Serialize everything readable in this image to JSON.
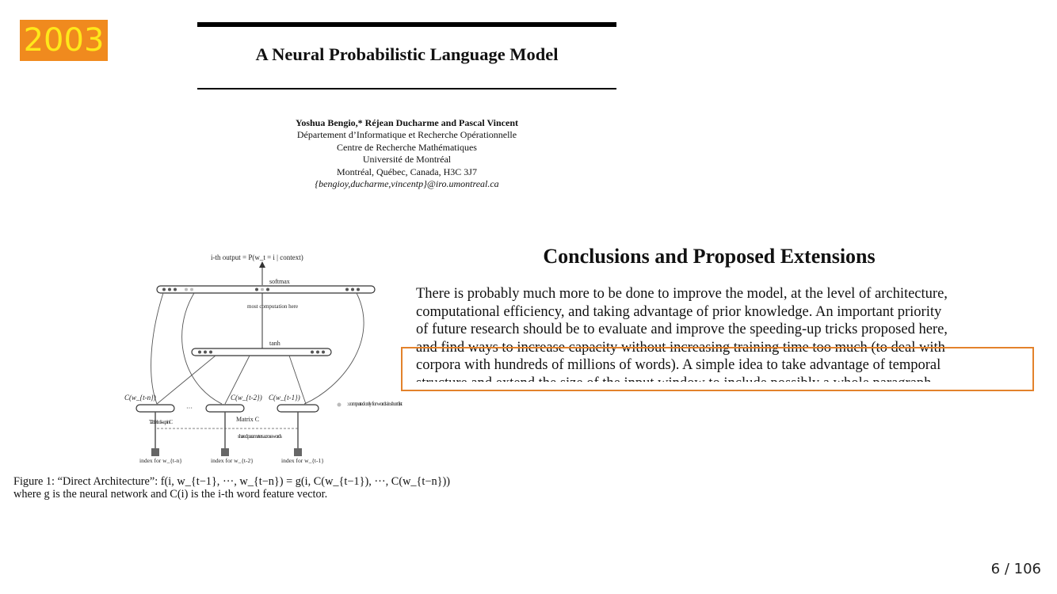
{
  "badge": {
    "year": "2003",
    "bg": "#f08a1e",
    "fg": "#ffe81a"
  },
  "paper": {
    "title": "A Neural Probabilistic Language Model",
    "authors": "Yoshua Bengio,* Réjean Ducharme and Pascal Vincent",
    "affiliation_lines": [
      "Département d’Informatique et Recherche Opérationnelle",
      "Centre de Recherche Mathématiques",
      "Université de Montréal",
      "Montréal, Québec, Canada, H3C 3J7"
    ],
    "email": "{bengioy,ducharme,vincentp}@iro.umontreal.ca"
  },
  "figure": {
    "output_label": "i-th output = P(w_t = i | context)",
    "softmax_label": "softmax",
    "most_computation_label": "most  computation here",
    "tanh_label": "tanh",
    "c_labels": [
      "C(w_{t-n})",
      "C(w_{t-2})",
      "C(w_{t-1})"
    ],
    "computed_only_label": ": computed only for words in short list",
    "table_lookup_label": "Table look-up in C",
    "matrix_label": "Matrix C",
    "shared_label": "shared parameters across words",
    "index_labels": [
      "index for w_{t-n}",
      "index for w_{t-2}",
      "index for w_{t-1}"
    ],
    "caption_line1": "Figure 1: “Direct Architecture”: f(i, w_{t−1}, ···, w_{t−n}) = g(i, C(w_{t−1}), ···, C(w_{t−n}))",
    "caption_line2": "where g is the neural network and C(i) is the i-th word feature vector."
  },
  "conclusions": {
    "title": "Conclusions and Proposed Extensions",
    "lines": [
      "There is probably much more to be done to improve the model, at the level of architecture,",
      "computational efficiency, and taking advantage of prior knowledge. An important priority",
      "of future research should be to evaluate and improve the speeding-up tricks proposed here,",
      "and find ways to increase capacity without increasing training time too much (to deal with",
      " corpora with hundreds of millions of words). A simple idea to take advantage of temporal",
      "structure and extend the size of the input window to include possibly a whole paragraph"
    ],
    "highlight_color": "#e3822b"
  },
  "slide": {
    "page_number": "6 / 106"
  }
}
